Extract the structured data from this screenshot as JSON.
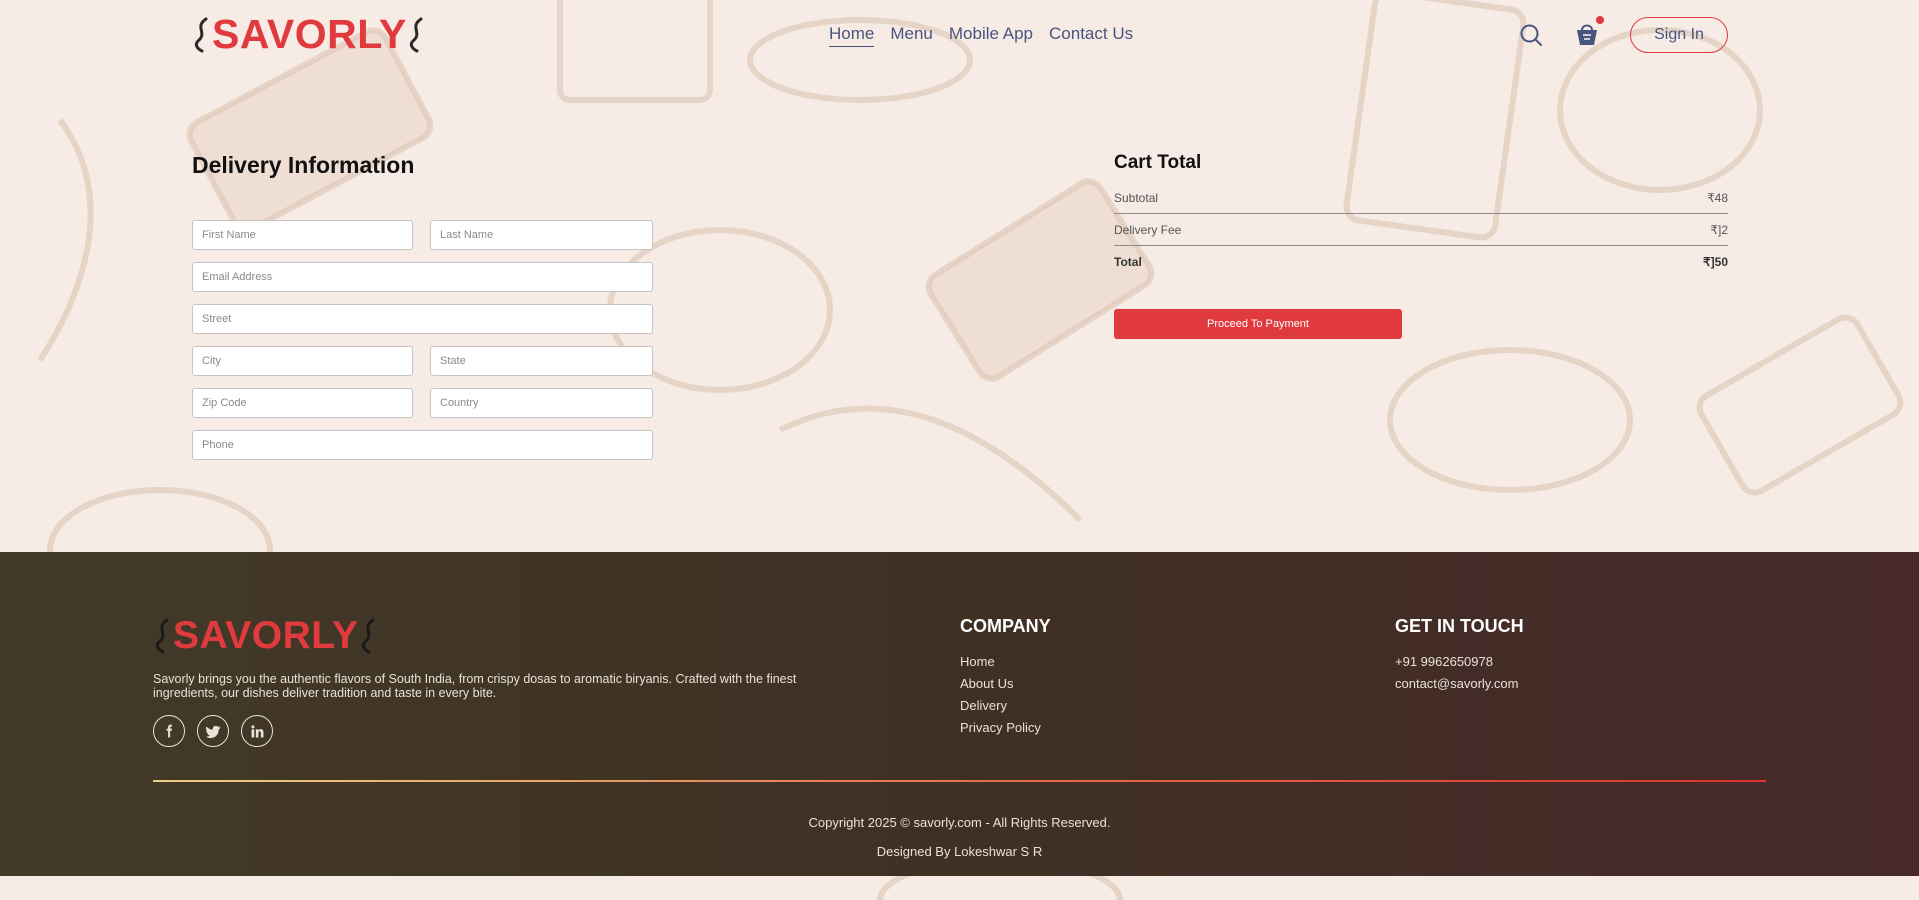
{
  "brand": {
    "name": "SAVORLY",
    "accent_color": "#e03a3e",
    "nav_text_color": "#49557e"
  },
  "nav": {
    "links": [
      "Home",
      "Menu",
      "Mobile App",
      "Contact Us"
    ],
    "active": "Home",
    "signin_label": "Sign In",
    "icons": [
      "search-icon",
      "basket-icon"
    ]
  },
  "delivery": {
    "title": "Delivery Information",
    "placeholders": {
      "first_name": "First Name",
      "last_name": "Last Name",
      "email": "Email Address",
      "street": "Street",
      "city": "City",
      "state": "State",
      "zip": "Zip Code",
      "country": "Country",
      "phone": "Phone"
    }
  },
  "cart": {
    "title": "Cart Total",
    "subtotal_label": "Subtotal",
    "subtotal_value": "₹48",
    "delivery_label": "Delivery Fee",
    "delivery_value": "₹]2",
    "total_label": "Total",
    "total_value": "₹]50",
    "pay_label": "Proceed To Payment"
  },
  "footer": {
    "description": "Savorly brings you the authentic flavors of South India, from crispy dosas to aromatic biryanis. Crafted with the finest ingredients, our dishes deliver tradition and taste in every bite.",
    "socials": [
      "facebook-icon",
      "twitter-icon",
      "linkedin-icon"
    ],
    "company_heading": "COMPANY",
    "company_links": [
      "Home",
      "About Us",
      "Delivery",
      "Privacy Policy"
    ],
    "contact_heading": "GET IN TOUCH",
    "phone": "+91 9962650978",
    "email": "contact@savorly.com",
    "copyright": "Copyright 2025 © savorly.com - All Rights Reserved.",
    "designed_by": "Designed By Lokeshwar S R"
  }
}
